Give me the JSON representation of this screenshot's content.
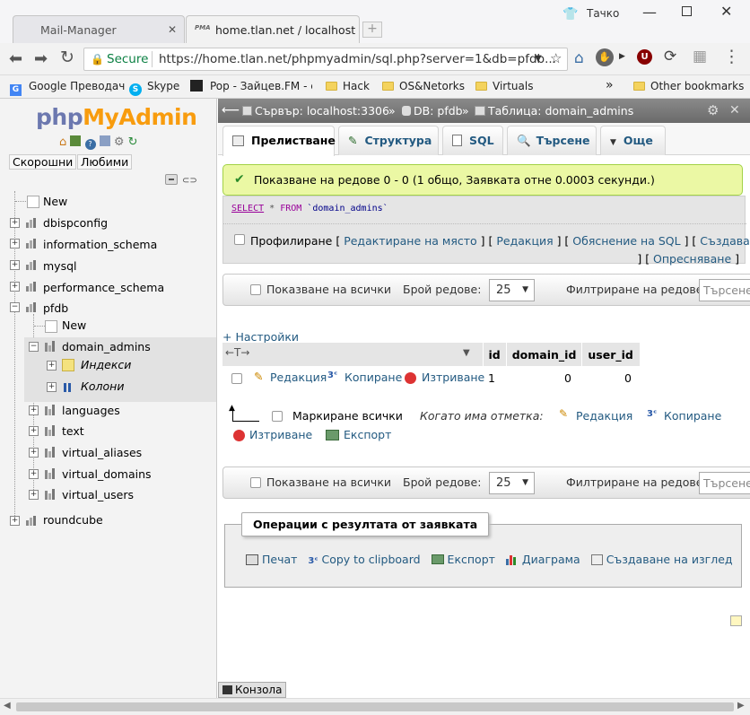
{
  "browser": {
    "tabs": [
      {
        "title": "Mail-Manager",
        "active": false
      },
      {
        "title": "home.tlan.net / localhost",
        "active": true
      }
    ],
    "user": "Тачко",
    "security_label": "Secure",
    "url": "https://home.tlan.net/phpmyadmin/sql.php?server=1&db=pfdb...",
    "bookmarks": [
      "Google Преводач",
      "Skype",
      "Pop - Зайцев.FM - с/",
      "Hack",
      "OS&Netorks",
      "Virtuals"
    ],
    "bookmarks_more": "»",
    "other_bookmarks": "Other bookmarks"
  },
  "sidebar": {
    "logo_php": "php",
    "logo_myadmin": "MyAdmin",
    "recent_label": "Скорошни",
    "favorites_label": "Любими",
    "tree": {
      "new": "New",
      "databases": [
        "dbispconfig",
        "information_schema",
        "mysql",
        "performance_schema",
        "pfdb",
        "roundcube"
      ],
      "pfdb_new": "New",
      "selected_table": "domain_admins",
      "indexes": "Индекси",
      "columns": "Колони",
      "tables": [
        "languages",
        "text",
        "virtual_aliases",
        "virtual_domains",
        "virtual_users"
      ]
    }
  },
  "breadcrumb": {
    "server": "Сървър: localhost:3306",
    "sep": "»",
    "db": "DB: pfdb",
    "table": "Таблица: domain_admins"
  },
  "tabs": [
    "Прелистване",
    "Структура",
    "SQL",
    "Търсене",
    "Още"
  ],
  "success_message": "Показване на редове 0 - 0 (1 общо, Заявката отне 0.0003 секунди.)",
  "sql": {
    "kw_select": "SELECT",
    "star": "*",
    "kw_from": "FROM",
    "table": "`domain_admins`"
  },
  "profiling": {
    "label": "Профилиране",
    "links": [
      "Редактиране на място",
      "Редакция",
      "Обяснение на SQL",
      "Създаване на PHP код",
      "Опресняване"
    ]
  },
  "nav": {
    "show_all": "Показване на всички",
    "row_count_label": "Брой редове:",
    "row_count": "25",
    "filter_label": "Филтриране на редове:",
    "filter_placeholder": "Търсене"
  },
  "options_link": "+ Настройки",
  "results": {
    "columns": [
      "id",
      "domain_id",
      "user_id"
    ],
    "rows": [
      {
        "actions": [
          "Редакция",
          "Копиране",
          "Изтриване"
        ],
        "values": [
          "1",
          "0",
          "0"
        ]
      }
    ]
  },
  "bulk": {
    "check_all": "Маркиране всички",
    "with_selected": "Когато има отметка:",
    "edit": "Редакция",
    "copy": "Копиране",
    "delete": "Изтриване",
    "export": "Експорт"
  },
  "query_ops": {
    "legend": "Операции с резултата от заявката",
    "print": "Печат",
    "copy_clipboard": "Copy to clipboard",
    "export": "Експорт",
    "chart": "Диаграма",
    "create_view": "Създаване на изглед"
  },
  "console_label": "Конзола",
  "colors": {
    "link": "#235a81",
    "success_bg": "#ebf8a4",
    "success_border": "#a2d246",
    "orange": "#f89c0e"
  }
}
